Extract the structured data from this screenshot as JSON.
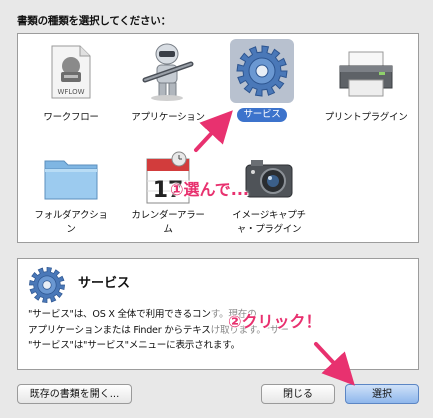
{
  "dialog": {
    "prompt": "書類の種類を選択してください："
  },
  "document_types": [
    {
      "label": "ワークフロー",
      "icon": "workflow-file-icon",
      "file_badge": "WFLOW"
    },
    {
      "label": "アプリケーション",
      "icon": "automator-robot-icon"
    },
    {
      "label": "サービス",
      "icon": "gear-icon",
      "selected": true
    },
    {
      "label": "プリントプラグイン",
      "icon": "printer-icon"
    },
    {
      "label": "フォルダアクション",
      "icon": "folder-icon"
    },
    {
      "label": "カレンダーアラーム",
      "icon": "calendar-icon",
      "calendar_day": "17"
    },
    {
      "label": "イメージキャプチャ・プラグイン",
      "icon": "camera-icon"
    }
  ],
  "detail": {
    "title": "サービス",
    "description_lines": [
      "\"サービス\"は、OS X 全体で利用できるコン",
      "アプリケーションまたは Finder からテキス",
      "\"サービス\"は\"サービス\"メニューに表示されます。"
    ],
    "description_line1_tail": "す。現在の",
    "description_line2_tail": "け取ります。\"サー"
  },
  "buttons": {
    "open_existing": "既存の書類を開く...",
    "close": "閉じる",
    "choose": "選択"
  },
  "annotations": {
    "step1": "①選んで...",
    "step2": "②クリック！",
    "color": "#e8316f"
  },
  "colors": {
    "selection_pill": "#3c73cc",
    "selection_bg": "#b8c1cf"
  }
}
